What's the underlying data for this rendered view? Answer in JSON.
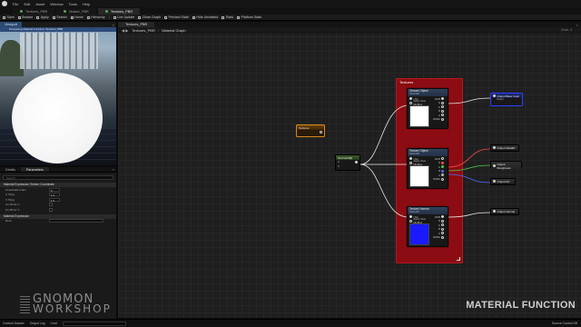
{
  "app": {
    "menu": [
      "File",
      "Edit",
      "Asset",
      "Window",
      "Tools",
      "Help"
    ],
    "tabs": [
      {
        "label": "Textures_PBR",
        "active": false
      },
      {
        "label": "Master_PBR",
        "active": false
      },
      {
        "label": "Textures_PBR",
        "active": true
      }
    ]
  },
  "toolbar": {
    "items": [
      "Save",
      "Browse",
      "Apply",
      "Search",
      "Home",
      "Hierarchy",
      "Live Update",
      "Clean Graph",
      "Preview State",
      "Hide Unrelated",
      "Stats",
      "Platform Stats"
    ]
  },
  "viewport": {
    "tab_label": "Viewport",
    "info_bar": "Previewing Material Function: Textures_PBR"
  },
  "details": {
    "tabs": [
      "Details",
      "Parameters"
    ],
    "search_placeholder": "Search",
    "section1": "Material Expression Texture Coordinate",
    "rows": [
      {
        "label": "Coordinate Index",
        "value": "0"
      },
      {
        "label": "U Tiling",
        "value": "1.0"
      },
      {
        "label": "V Tiling",
        "value": "1.0"
      },
      {
        "label": "Un Mirror U",
        "value": ""
      },
      {
        "label": "Un Mirror V",
        "value": ""
      }
    ],
    "section2": "Material Expression",
    "desc_label": "Desc"
  },
  "graph": {
    "tab_label": "Textures_PBR",
    "breadcrumb": [
      "Textures_PBR",
      "Material Graph"
    ],
    "zoom": "Zoom -3",
    "comment_title": "Textures",
    "param_node": {
      "title": "Textures",
      "sub": ""
    },
    "coord_node": {
      "title": "TexCoord[0]",
      "pins": [
        "U",
        "V"
      ]
    },
    "texture_nodes": [
      {
        "title": "Texture Object",
        "sub": "Param2D",
        "input": "UVs",
        "apply": "Apply View MipBias",
        "outputs": [
          "RGB",
          "R",
          "G",
          "B",
          "A",
          "RGBA"
        ],
        "preview": "white"
      },
      {
        "title": "Texture Object",
        "sub": "Param2D",
        "input": "UVs",
        "apply": "Apply View MipBias",
        "outputs": [
          "RGB",
          "R",
          "G",
          "B",
          "A",
          "RGBA"
        ],
        "preview": "white"
      },
      {
        "title": "Texture Normal",
        "sub": "Param2D",
        "input": "UVs",
        "apply": "Apply View MipBias",
        "outputs": [
          "RGB",
          "R",
          "G",
          "B",
          "A",
          "RGBA"
        ],
        "preview": "blue"
      }
    ],
    "outputs": [
      {
        "title": "Output Base Color",
        "sub": "Output",
        "selected": true
      },
      {
        "title": "Output Metallic",
        "sub": "",
        "selected": false
      },
      {
        "title": "Output Roughness",
        "sub": "",
        "selected": false
      },
      {
        "title": "Output AO",
        "sub": "",
        "selected": false
      },
      {
        "title": "Output Normal",
        "sub": "",
        "selected": false
      }
    ],
    "watermark": "MATERIAL FUNCTION"
  },
  "branding": {
    "line1": "GNOMON",
    "line2": "WORKSHOP"
  },
  "statusbar": {
    "items": [
      "Content Drawer",
      "Output Log",
      "Cmd"
    ],
    "right": "Source Control Off"
  },
  "colors": {
    "comment": "#8b0c12",
    "selected_output": "#2d3eff",
    "param": "#d58a1a"
  }
}
